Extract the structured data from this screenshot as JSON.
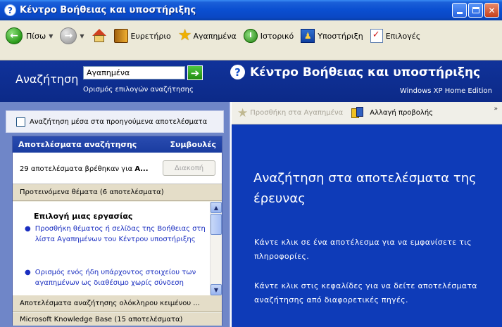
{
  "window": {
    "title": "Κέντρο Βοήθειας και υποστήριξης",
    "help_glyph": "?"
  },
  "toolbar": {
    "back_label": "Πίσω",
    "index_label": "Ευρετήριο",
    "favorites_label": "Αγαπημένα",
    "history_label": "Ιστορικό",
    "support_label": "Υποστήριξη",
    "options_label": "Επιλογές"
  },
  "search": {
    "label": "Αναζήτηση",
    "value": "Αγαπημένα",
    "options_link": "Ορισμός επιλογών αναζήτησης"
  },
  "header": {
    "title": "Κέντρο Βοήθειας και υποστήριξης",
    "edition": "Windows XP Home Edition"
  },
  "left": {
    "search_previous_label": "Αναζήτηση μέσα στα προηγούμενα αποτελέσματα",
    "results_header": "Αποτελέσματα αναζήτησης",
    "tips_link": "Συμβουλές",
    "results_count_prefix": "29 αποτελέσματα βρέθηκαν για ",
    "results_count_query": "Α...",
    "stop_button": "Διακοπή",
    "suggested_topics": "Προτεινόμενα θέματα (6 αποτελέσματα)",
    "task_heading": "Επιλογή μιας εργασίας",
    "topics": [
      "Προσθήκη θέματος ή σελίδας της Βοήθειας στη λίστα Αγαπημένων του Κέντρου υποστήριξης",
      "Ορισμός ενός ήδη υπάρχοντος στοιχείου των αγαπημένων ως διαθέσιμο χωρίς σύνδεση"
    ],
    "full_text_results": "Αποτελέσματα αναζήτησης ολόκληρου κειμένου ...",
    "knowledge_base": "Microsoft Knowledge Base (15 αποτελέσματα)"
  },
  "right": {
    "add_to_favorites": "Προσθήκη στα Αγαπημένα",
    "change_view": "Αλλαγή προβολής",
    "more": "»",
    "heading": "Αναζήτηση στα αποτελέσματα της έρευνας",
    "para1": "Κάντε κλικ σε ένα αποτέλεσμα για να εμφανίσετε τις πληροφορίες.",
    "para2": "Κάντε κλικ στις κεφαλίδες για να δείτε αποτελέσματα αναζήτησης από διαφορετικές πηγές."
  },
  "colors": {
    "title_bar": "#0a4ed0",
    "search_band": "#10329a",
    "content_blue": "#0e3bb8",
    "link_blue": "#1a2ec0"
  }
}
